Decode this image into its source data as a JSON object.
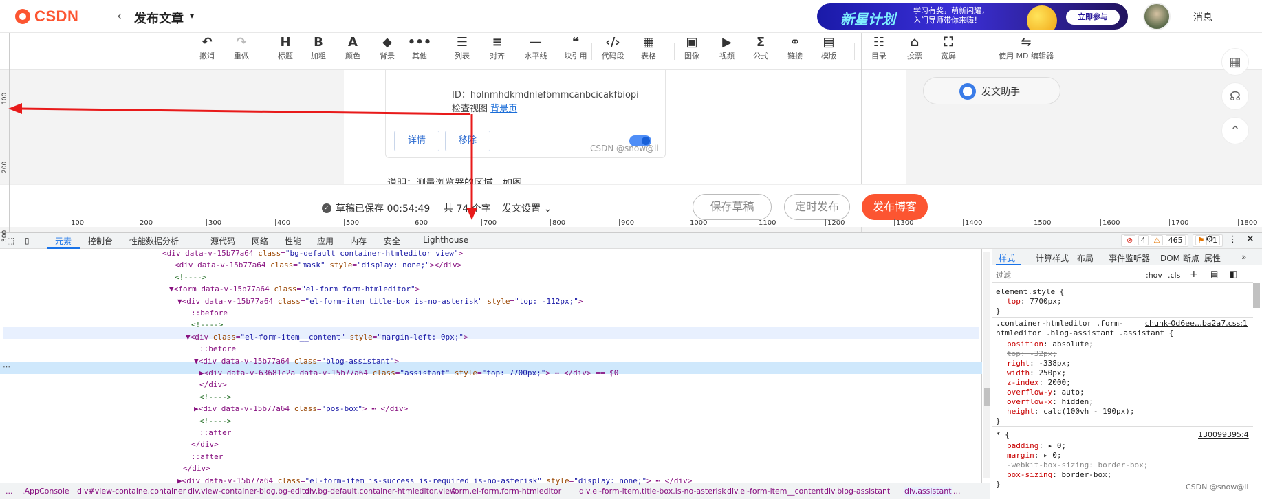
{
  "header": {
    "logo_text": "CSDN",
    "back_glyph": "‹",
    "page_title": "发布文章",
    "title_caret": "▾",
    "banner": {
      "big": "新星计划",
      "line1": "学习有奖，萌新闪耀，",
      "line2": "入门导师带你来嗨！",
      "join": "立即参与"
    },
    "messages": "消息"
  },
  "toolbar": [
    {
      "icon": "undo-icon",
      "glyph": "↶",
      "label": "撤消",
      "disabled": false
    },
    {
      "icon": "redo-icon",
      "glyph": "↷",
      "label": "重做",
      "disabled": true
    },
    {
      "icon": "heading-icon",
      "glyph": "H",
      "label": "标题"
    },
    {
      "icon": "bold-icon",
      "glyph": "B",
      "label": "加粗"
    },
    {
      "icon": "text-color-icon",
      "glyph": "A",
      "label": "颜色"
    },
    {
      "icon": "background-icon",
      "glyph": "◆",
      "label": "背景"
    },
    {
      "icon": "more-icon",
      "glyph": "•••",
      "label": "其他"
    },
    {
      "icon": "list-icon",
      "glyph": "☰",
      "label": "列表"
    },
    {
      "icon": "align-icon",
      "glyph": "≡",
      "label": "对齐"
    },
    {
      "icon": "horizontal-line-icon",
      "glyph": "—",
      "label": "水平线"
    },
    {
      "icon": "quote-icon",
      "glyph": "❝",
      "label": "块引用"
    },
    {
      "icon": "code-icon",
      "glyph": "‹/›",
      "label": "代码段"
    },
    {
      "icon": "table-icon",
      "glyph": "▦",
      "label": "表格"
    },
    {
      "icon": "image-icon",
      "glyph": "▣",
      "label": "图像"
    },
    {
      "icon": "video-icon",
      "glyph": "▶",
      "label": "视频"
    },
    {
      "icon": "formula-icon",
      "glyph": "Σ",
      "label": "公式"
    },
    {
      "icon": "link-icon",
      "glyph": "⚭",
      "label": "链接"
    },
    {
      "icon": "template-icon",
      "glyph": "▤",
      "label": "模版"
    },
    {
      "icon": "toc-icon",
      "glyph": "☷",
      "label": "目录"
    },
    {
      "icon": "vote-icon",
      "glyph": "⌂",
      "label": "投票"
    },
    {
      "icon": "widescreen-icon",
      "glyph": "⛶",
      "label": "宽屏"
    },
    {
      "icon": "md-editor-icon",
      "glyph": "⇋",
      "label": "使用 MD 编辑器"
    }
  ],
  "editor": {
    "id_line": "ID：holnmhdkmdnlefbmmcanbcicakfbiopi",
    "view_label": "检查视图",
    "view_link": "背景页",
    "detail_btn": "详情",
    "remove_btn": "移除",
    "watermark": "CSDN @snow@li",
    "note": "说明：测量浏览器的区域，如图",
    "assistant": "发文助手"
  },
  "footer": {
    "saved": "草稿已保存 00:54:49",
    "count": "共 74 个字",
    "publish_settings": "发文设置",
    "save_draft": "保存草稿",
    "timed_publish": "定时发布",
    "publish": "发布博客"
  },
  "rulers": {
    "h_ticks": [
      "100",
      "200",
      "300",
      "400",
      "500",
      "600",
      "700",
      "800",
      "900",
      "1000",
      "1100",
      "1200",
      "1300",
      "1400",
      "1500",
      "1600",
      "1700",
      "1800"
    ],
    "v_ticks": [
      "100",
      "200",
      "300"
    ]
  },
  "devtools": {
    "tabs": [
      "元素",
      "控制台",
      "性能数据分析",
      "源代码",
      "网络",
      "性能",
      "应用",
      "内存",
      "安全",
      "Lighthouse"
    ],
    "active_tab": "元素",
    "errors": "4",
    "warnings": "465",
    "issues": "1",
    "dom": [
      "<div data-v-15b77a64 class=\"bg-default container-htmleditor view\">",
      "<div data-v-15b77a64 class=\"mask\" style=\"display: none;\"></div>",
      "<!---->",
      "▼<form data-v-15b77a64 class=\"el-form form-htmleditor\">",
      "▼<div data-v-15b77a64 class=\"el-form-item title-box is-no-asterisk\" style=\"top: -112px;\">",
      "::before",
      "<!---->",
      "▼<div class=\"el-form-item__content\" style=\"margin-left: 0px;\">",
      "::before",
      "▼<div data-v-15b77a64 class=\"blog-assistant\">",
      "▶<div data-v-63681c2a data-v-15b77a64 class=\"assistant\" style=\"top: 7700px;\"> ⋯ </div> == $0",
      "</div>",
      "<!---->",
      "▶<div data-v-15b77a64 class=\"pos-box\"> ⋯ </div>",
      "<!---->",
      "::after",
      "</div>",
      "::after",
      "</div>",
      "▶<div data-v-15b77a64 class=\"el-form-item is-success is-required is-no-asterisk\" style=\"display: none;\"> ⋯ </div>"
    ],
    "breadcrumbs": [
      "...",
      ".AppConsole",
      "div#view-containe.container",
      "div.view-container-blog.bg-editor.",
      "div.bg-default.container-htmleditor.view",
      "form.el-form.form-htmleditor",
      "div.el-form-item.title-box.is-no-asterisk",
      "div.el-form-item__content",
      "div.blog-assistant",
      "div.assistant",
      "..."
    ],
    "styles_tabs": [
      "样式",
      "计算样式",
      "布局",
      "事件监听器",
      "DOM 断点",
      "属性",
      "»"
    ],
    "filter_placeholder": "过滤",
    "filter_tools": [
      ":hov",
      ".cls",
      "+"
    ],
    "rules": {
      "element_style_selector": "element.style {",
      "element_style_prop": "top",
      "element_style_val": "7700px;",
      "rule1_selector_a": ".container-htmleditor .form-",
      "rule1_selector_b": "htmleditor .blog-assistant .assistant {",
      "rule1_source": "chunk-0d6ee…ba2a7.css:1",
      "rule1_props": [
        {
          "p": "position",
          "v": "absolute;",
          "s": false
        },
        {
          "p": "top",
          "v": "-32px;",
          "s": true
        },
        {
          "p": "right",
          "v": "-338px;",
          "s": false
        },
        {
          "p": "width",
          "v": "250px;",
          "s": false
        },
        {
          "p": "z-index",
          "v": "2000;",
          "s": false
        },
        {
          "p": "overflow-y",
          "v": "auto;",
          "s": false
        },
        {
          "p": "overflow-x",
          "v": "hidden;",
          "s": false
        },
        {
          "p": "height",
          "v": "calc(100vh - 190px);",
          "s": false
        }
      ],
      "rule2_selector": "* {",
      "rule2_source": "130099395:4",
      "rule2_props": [
        {
          "p": "padding",
          "v": "▸ 0;",
          "s": false
        },
        {
          "p": "margin",
          "v": "▸ 0;",
          "s": false
        },
        {
          "p": "-webkit-box-sizing",
          "v": "border-box;",
          "s": true
        },
        {
          "p": "box-sizing",
          "v": "border-box;",
          "s": false
        }
      ]
    },
    "watermark": "CSDN @snow@li"
  },
  "colors": {
    "brand": "#fc5531",
    "link": "#1a6dd8",
    "arrow": "#e81a1a",
    "devtools_accent": "#1a73e8"
  }
}
